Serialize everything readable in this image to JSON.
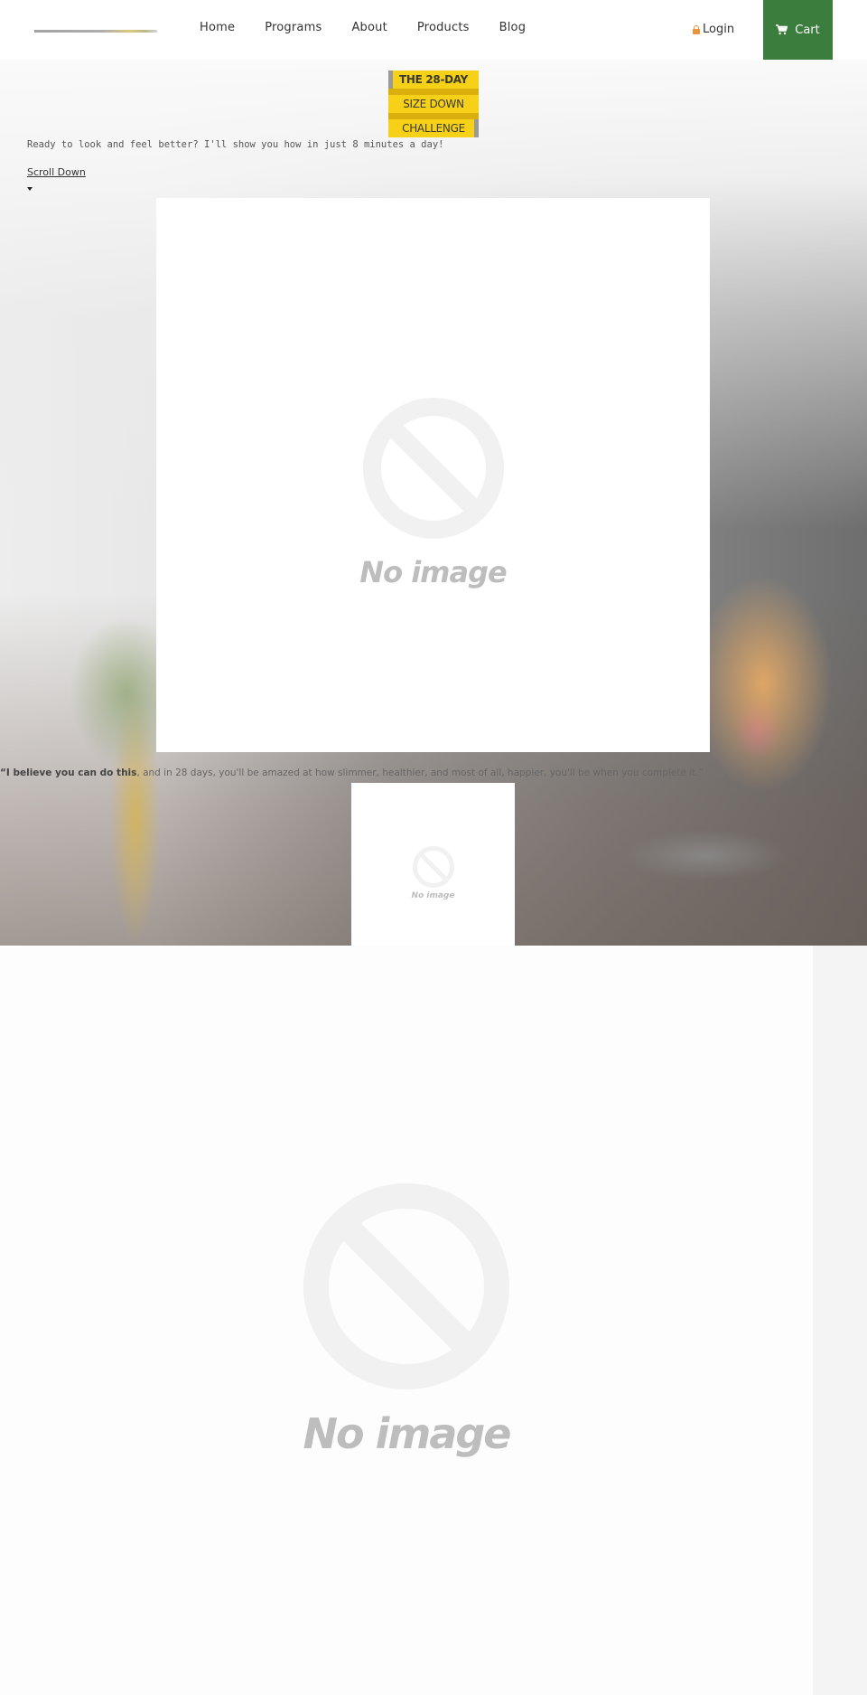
{
  "header": {
    "logo_alt": "site-logo",
    "nav": [
      {
        "label": "Home"
      },
      {
        "label": "Programs"
      },
      {
        "label": "About"
      },
      {
        "label": "Products"
      },
      {
        "label": "Blog"
      }
    ],
    "login_label": "Login",
    "cart_label": "Cart",
    "colors": {
      "cart_bg": "#3b7d3c",
      "lock": "#e8943a"
    }
  },
  "hero": {
    "badge": {
      "line1": "THE 28-DAY",
      "line2": "SIZE DOWN",
      "line3": "CHALLENGE",
      "color": "#f7d117"
    },
    "tagline": "Ready to look and feel better? I'll show you how in just 8 minutes a day!",
    "scroll_label": "Scroll Down",
    "main_image_caption": "No image",
    "quote_bold": "“I believe you can do this",
    "quote_rest": ", and in 28 days, you'll be amazed at how slimmer, healthier, and most of all, happier, you'll be when you complete it.”",
    "small_image_caption": "No image"
  },
  "lower": {
    "large_image_caption": "No image"
  }
}
